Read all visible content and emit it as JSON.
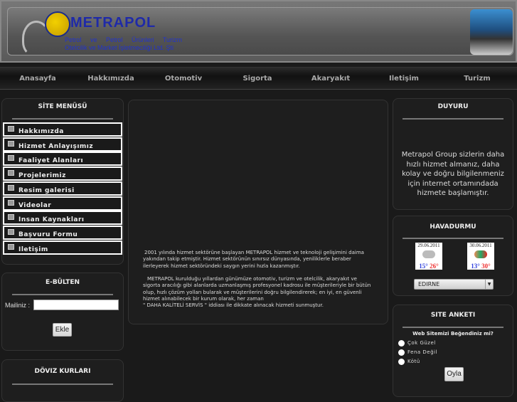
{
  "header": {
    "brand": "METRAPOL",
    "tagline1": "Petrol ve Petrol Ürünleri Turizm",
    "tagline2": "Otelcilik ve Market İşletmeciliği Ltd. Şti"
  },
  "nav": [
    "Anasayfa",
    "Hakkımızda",
    "Otomotiv",
    "Sigorta",
    "Akaryakıt",
    "Iletişim",
    "Turizm"
  ],
  "site_menu": {
    "title": "SİTE MENÜSÜ",
    "items": [
      "Hakkımızda",
      "Hizmet Anlayışımız",
      "Faaliyet Alanları",
      "Projelerimiz",
      "Resim galerisi",
      "Videolar",
      "Insan Kaynakları",
      "Başvuru Formu",
      "Iletişim"
    ]
  },
  "ebulten": {
    "title": "E-BÜLTEN",
    "label": "Mailiniz :",
    "value": "",
    "button": "Ekle"
  },
  "doviz": {
    "title": "DÖVIZ KURLARI"
  },
  "content": {
    "p1": "2001 yılında hizmet sektörüne başlayan METRAPOL hizmet ve teknoloji gelişimini daima yakından takip etmiştir. Hizmet sektörünün sınırsız dünyasında, yeniliklerle beraber ilerleyerek hizmet sektöründeki saygın yerini hızla kazanmıştır.",
    "p2": "METRAPOL kurulduğu yıllardan günümüze otomotiv, turizm ve otelcilik, akaryakıt ve sigorta aracılığı gibi alanlarda uzmanlaşmış profesyonel kadrosu ile müşterileriyle bir bütün olup, hızlı çözüm yolları bularak ve müşterilerini doğru bilgilendirerek; en iyi, en güvenli hizmet alınabilecek bir kurum olarak, her zaman",
    "p3": "\"  DAHA KALİTELİ SERVİS \" iddiası ile dikkate alınacak hizmeti sunmuştur."
  },
  "duyuru": {
    "title": "DUYURU",
    "text": "Metrapol Group sizlerin daha hızlı hizmet almanız, daha kolay ve doğru bilgilenmeniz için internet ortamındada hizmete başlamıştır."
  },
  "havadurmu": {
    "title": "HAVADURMU",
    "days": [
      {
        "date": "29.06.2011",
        "low": "15°",
        "high": "26°"
      },
      {
        "date": "30.06.2011",
        "low": "13°",
        "high": "30°"
      }
    ],
    "city": "EDIRNE"
  },
  "anket": {
    "title": "SITE ANKETI",
    "question": "Web Sitemizi Beğendiniz mi?",
    "options": [
      "Çok Güzel",
      "Fena Değil",
      "Kötü"
    ],
    "button": "Oyla"
  }
}
